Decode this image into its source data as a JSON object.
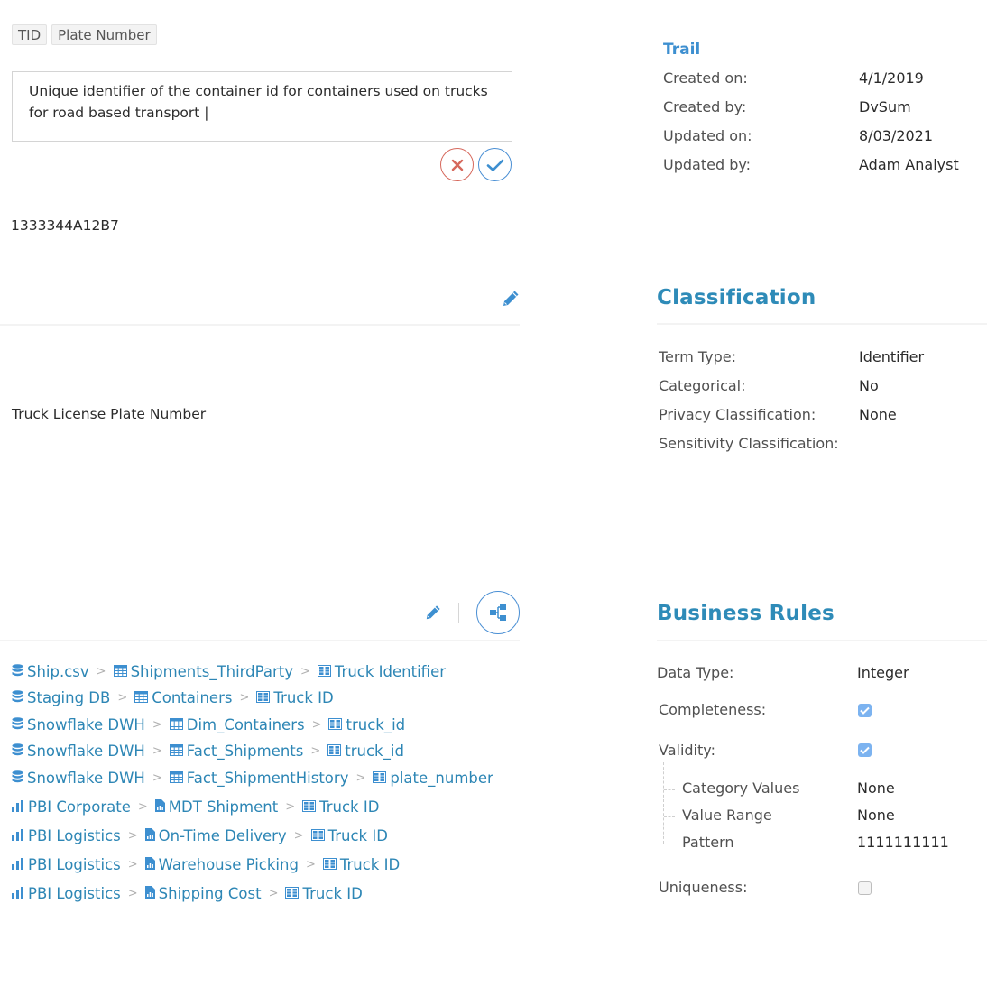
{
  "tags": [
    "TID",
    "Plate Number"
  ],
  "description": {
    "value": "Unique identifier of the container id for containers used on trucks for road based transport |",
    "cancel_icon": "close-icon",
    "confirm_icon": "check-icon"
  },
  "sample_value": "1333344A12B7",
  "edit_icon": "pencil-icon",
  "display_name": "Truck License Plate Number",
  "trail": {
    "title": "Trail",
    "rows": [
      {
        "label": "Created on:",
        "value": "4/1/2019"
      },
      {
        "label": "Created by:",
        "value": "DvSum"
      },
      {
        "label": "Updated on:",
        "value": "8/03/2021"
      },
      {
        "label": "Updated by:",
        "value": "Adam Analyst"
      }
    ]
  },
  "classification": {
    "title": "Classification",
    "rows": [
      {
        "label": "Term Type:",
        "value": "Identifier"
      },
      {
        "label": "Categorical:",
        "value": "No"
      },
      {
        "label": "Privacy Classification:",
        "value": "None"
      },
      {
        "label": "Sensitivity Classification:",
        "value": ""
      }
    ]
  },
  "lineage": {
    "edit_icon": "pencil-icon",
    "graph_icon": "hierarchy-icon",
    "paths": [
      {
        "source_icon": "database-icon",
        "source": "Ship.csv",
        "mid_icon": "table-icon",
        "mid": "Shipments_ThirdParty",
        "leaf_icon": "column-icon",
        "leaf": "Truck Identifier"
      },
      {
        "source_icon": "database-icon",
        "source": "Staging DB",
        "mid_icon": "table-icon",
        "mid": "Containers",
        "leaf_icon": "column-icon",
        "leaf": "Truck ID"
      },
      {
        "source_icon": "database-icon",
        "source": "Snowflake DWH",
        "mid_icon": "table-icon",
        "mid": "Dim_Containers",
        "leaf_icon": "column-icon",
        "leaf": "truck_id"
      },
      {
        "source_icon": "database-icon",
        "source": "Snowflake DWH",
        "mid_icon": "table-icon",
        "mid": "Fact_Shipments",
        "leaf_icon": "column-icon",
        "leaf": "truck_id"
      },
      {
        "source_icon": "database-icon",
        "source": "Snowflake DWH",
        "mid_icon": "table-icon",
        "mid": "Fact_ShipmentHistory",
        "leaf_icon": "column-icon",
        "leaf": "plate_number"
      },
      {
        "source_icon": "bar-chart-icon",
        "source": "PBI Corporate",
        "mid_icon": "report-icon",
        "mid": "MDT Shipment",
        "leaf_icon": "column-icon",
        "leaf": "Truck ID"
      },
      {
        "source_icon": "bar-chart-icon",
        "source": "PBI Logistics",
        "mid_icon": "report-icon",
        "mid": "On-Time Delivery",
        "leaf_icon": "column-icon",
        "leaf": "Truck ID"
      },
      {
        "source_icon": "bar-chart-icon",
        "source": "PBI Logistics",
        "mid_icon": "report-icon",
        "mid": "Warehouse Picking",
        "leaf_icon": "column-icon",
        "leaf": "Truck ID"
      },
      {
        "source_icon": "bar-chart-icon",
        "source": "PBI Logistics",
        "mid_icon": "report-icon",
        "mid": "Shipping Cost",
        "leaf_icon": "column-icon",
        "leaf": "Truck ID"
      }
    ]
  },
  "business_rules": {
    "title": "Business Rules",
    "data_type": {
      "label": "Data Type:",
      "value": "Integer"
    },
    "completeness": {
      "label": "Completeness:",
      "checked": true
    },
    "validity": {
      "label": "Validity:",
      "checked": true
    },
    "validity_rules": [
      {
        "label": "Category Values",
        "value": "None"
      },
      {
        "label": "Value Range",
        "value": "None"
      },
      {
        "label": "Pattern",
        "value": "1111111111"
      }
    ],
    "uniqueness": {
      "label": "Uniqueness:",
      "checked": false
    }
  },
  "colors": {
    "accent": "#2e8bb8",
    "link": "#2d86b5",
    "icon_blue": "#3d8fd0",
    "cancel_red": "#d6685c",
    "checkbox_on": "#7cb3f0"
  }
}
